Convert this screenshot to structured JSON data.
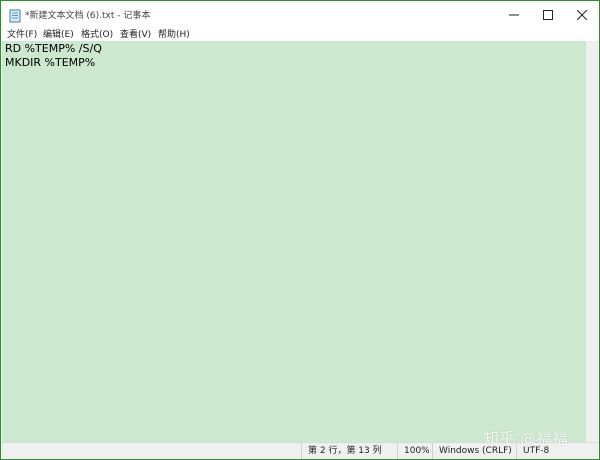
{
  "window": {
    "title": "*新建文本文档 (6).txt - 记事本",
    "minimize_icon": "minimize-icon",
    "maximize_icon": "maximize-icon",
    "close_icon": "close-icon"
  },
  "menu": {
    "items": [
      {
        "label": "文件(F)"
      },
      {
        "label": "编辑(E)"
      },
      {
        "label": "格式(O)"
      },
      {
        "label": "查看(V)"
      },
      {
        "label": "帮助(H)"
      }
    ]
  },
  "editor": {
    "lines": [
      "RD %TEMP% /S/Q",
      "MKDIR %TEMP%"
    ],
    "background_color": "#cce8cf"
  },
  "status": {
    "position": "第 2 行，第 13 列",
    "zoom": "100%",
    "line_ending": "Windows (CRLF)",
    "encoding": "UTF-8"
  },
  "watermark": {
    "text": "知乎 @福福"
  },
  "colors": {
    "window_border": "#2a8f2a",
    "editor_bg": "#cce8cf"
  }
}
